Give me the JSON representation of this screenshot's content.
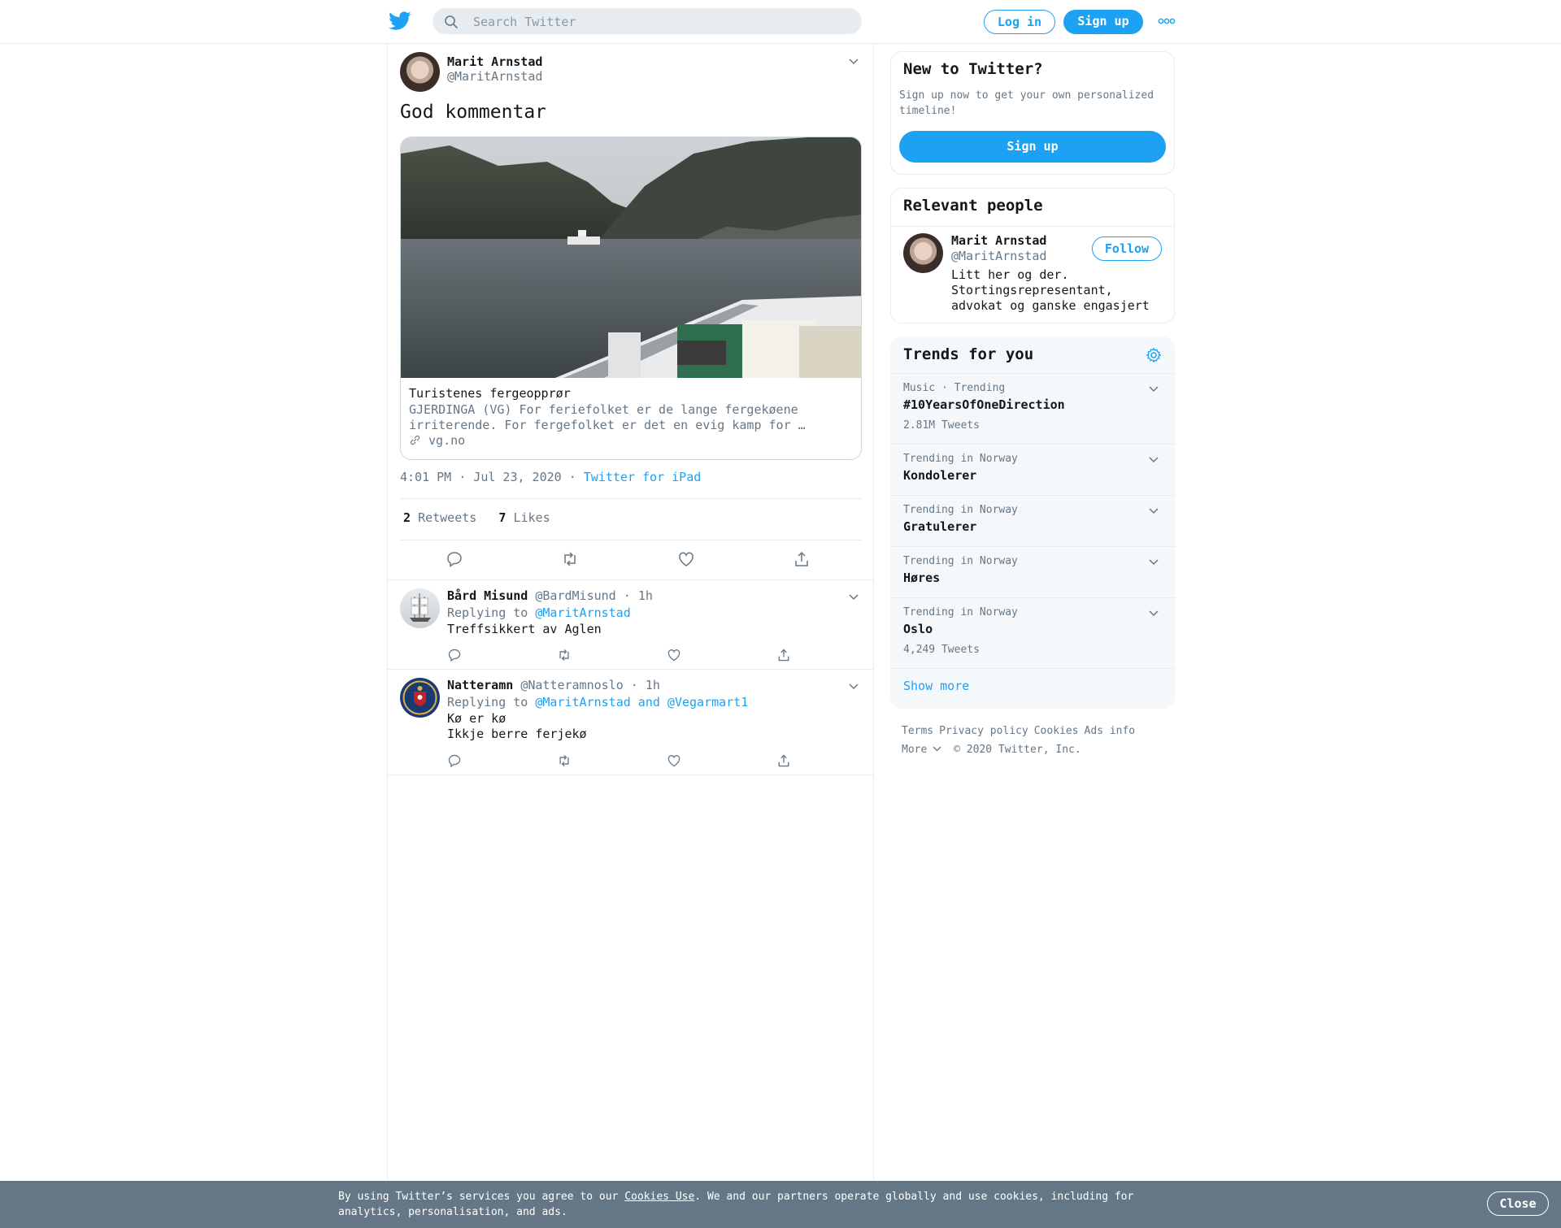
{
  "colors": {
    "accent": "#1da1f2",
    "muted": "#657786",
    "border": "#e6ecf0",
    "cookie_bg": "#657786"
  },
  "topbar": {
    "search_placeholder": "Search Twitter",
    "login_label": "Log in",
    "signup_label": "Sign up",
    "icons": [
      "twitter-bird-icon",
      "search-icon",
      "more-dots-icon"
    ]
  },
  "tweet": {
    "author_name": "Marit Arnstad",
    "author_handle": "@MaritArnstad",
    "text": "God kommentar",
    "card": {
      "title": "Turistenes fergeopprør",
      "description": "GJERDINGA (VG) For feriefolket er de lange fergekøene irriterende. For fergefolket er det en evig kamp for …",
      "domain": "vg.no"
    },
    "time": "4:01 PM · Jul 23, 2020",
    "dot": "·",
    "source": "Twitter for iPad",
    "retweets_count": "2",
    "retweets_label": "Retweets",
    "likes_count": "7",
    "likes_label": "Likes",
    "action_icons": [
      "reply-icon",
      "retweet-icon",
      "like-icon",
      "share-icon"
    ]
  },
  "replies": [
    {
      "name": "Bård Misund",
      "handle": "@BardMisund",
      "sep": "·",
      "time": "1h",
      "replying_prefix": "Replying to",
      "replying_to": "@MaritArnstad",
      "text_lines": [
        "Treffsikkert av Aglen"
      ]
    },
    {
      "name": "Natteramn",
      "handle": "@Natteramnoslo",
      "sep": "·",
      "time": "1h",
      "replying_prefix": "Replying to",
      "replying_to": "@MaritArnstad and @Vegarmart1",
      "text_lines": [
        "Kø er kø",
        "Ikkje berre ferjekø"
      ]
    }
  ],
  "sidebar": {
    "new_title": "New to Twitter?",
    "new_text": "Sign up now to get your own personalized timeline!",
    "new_signup": "Sign up",
    "people_title": "Relevant people",
    "person": {
      "name": "Marit Arnstad",
      "handle": "@MaritArnstad",
      "bio": "Litt her og der. Stortingsrepresentant, advokat og ganske engasjert",
      "follow_label": "Follow"
    },
    "trends_title": "Trends for you",
    "trends": [
      {
        "context": "Music · Trending",
        "name": "#10YearsOfOneDirection",
        "count": "2.81M Tweets"
      },
      {
        "context": "Trending in Norway",
        "name": "Kondolerer",
        "count": ""
      },
      {
        "context": "Trending in Norway",
        "name": "Gratulerer",
        "count": ""
      },
      {
        "context": "Trending in Norway",
        "name": "Høres",
        "count": ""
      },
      {
        "context": "Trending in Norway",
        "name": "Oslo",
        "count": "4,249 Tweets"
      }
    ],
    "show_more": "Show more"
  },
  "footer": {
    "links": [
      "Terms",
      "Privacy policy",
      "Cookies",
      "Ads info"
    ],
    "more": "More",
    "copyright": "© 2020 Twitter, Inc."
  },
  "cookie": {
    "text_before": "By using Twitter’s services you agree to our ",
    "link": "Cookies Use",
    "text_after": ". We and our partners operate globally and use cookies, including for analytics, personalisation, and ads.",
    "close_label": "Close"
  }
}
